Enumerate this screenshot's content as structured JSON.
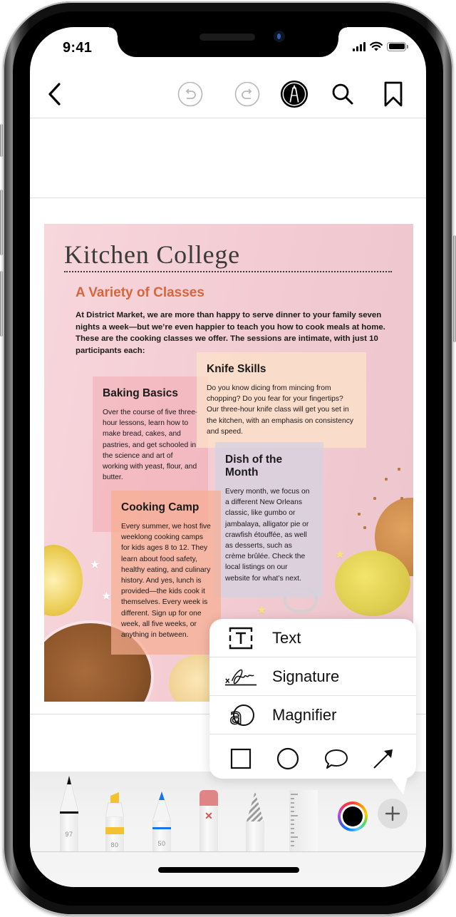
{
  "status_bar": {
    "time": "9:41",
    "icons": [
      "cellular-signal-icon",
      "wifi-icon",
      "battery-icon"
    ]
  },
  "navbar": {
    "back_icon": "chevron-left-icon",
    "undo_icon": "undo-icon",
    "redo_icon": "redo-icon",
    "markup_icon": "markup-pen-icon",
    "search_icon": "search-icon",
    "bookmark_icon": "bookmark-icon"
  },
  "document": {
    "title": "Kitchen College",
    "subtitle": "A Variety of Classes",
    "intro": "At District Market, we are more than happy to serve dinner to your family seven nights a week—but we’re even happier to teach you how to cook meals at home. These are the cooking classes we offer. The sessions are intimate, with just 10 participants each:",
    "classes": [
      {
        "title": "Baking Basics",
        "body": "Over the course of five three-hour lessons, learn how to make bread, cakes, and pastries, and get schooled in the science and art of working with yeast, flour, and butter."
      },
      {
        "title": "Knife Skills",
        "body": "Do you know dicing from mincing from chopping? Do you fear for your fingertips? Our three-hour knife class will get you set in the kitchen, with an emphasis on consistency and speed."
      },
      {
        "title": "Dish of the Month",
        "body": "Every month, we focus on a different New Orleans classic, like gumbo or jambalaya, alligator pie or crawfish étouffée, as well as desserts, such as crème brûlée. Check the local listings on our website for what’s next."
      },
      {
        "title": "Cooking Camp",
        "body": "Every summer, we host five weeklong cooking camps for kids ages 8 to 12. They learn about food safety, healthy eating, and culinary history. And yes, lunch is provided—the kids cook it themselves. Every week is different. Sign up for one week, all five weeks, or anything in between."
      }
    ],
    "colors": {
      "title": "#3a3a3a",
      "subtitle": "#d8663a",
      "background": "#f3ccd3"
    }
  },
  "popover": {
    "items": [
      {
        "label": "Text",
        "icon": "text-box-icon"
      },
      {
        "label": "Signature",
        "icon": "signature-icon"
      },
      {
        "label": "Magnifier",
        "icon": "magnifier-icon"
      }
    ],
    "shapes": [
      {
        "name": "square",
        "icon": "square-icon"
      },
      {
        "name": "circle",
        "icon": "circle-icon"
      },
      {
        "name": "speech-bubble",
        "icon": "speech-bubble-icon"
      },
      {
        "name": "arrow",
        "icon": "arrow-icon"
      }
    ]
  },
  "toolbar": {
    "tools": [
      {
        "name": "pen",
        "value": "97",
        "color": "#111111"
      },
      {
        "name": "highlighter",
        "value": "80",
        "color": "#f2c230"
      },
      {
        "name": "pencil",
        "value": "50",
        "color": "#1a73e8"
      },
      {
        "name": "eraser",
        "value": "",
        "color": "#e08585"
      },
      {
        "name": "lasso",
        "value": "",
        "color": "#bbbbbb"
      },
      {
        "name": "ruler",
        "value": "",
        "color": "#eeeeee"
      }
    ],
    "selected_color": "#000000",
    "add_icon": "plus-icon"
  }
}
